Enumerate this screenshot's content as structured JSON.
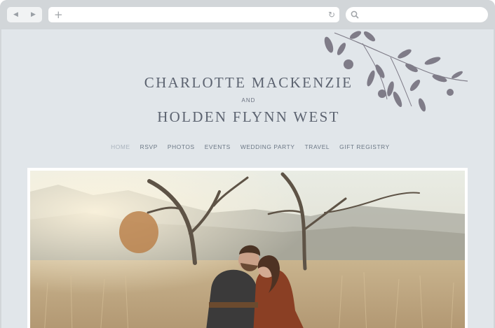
{
  "browser": {
    "back_icon": "back-arrow-icon",
    "forward_icon": "forward-arrow-icon",
    "new_tab_icon": "plus-icon",
    "reload_icon": "reload-icon",
    "search_icon": "search-icon",
    "back_glyph": "◀",
    "forward_glyph": "▶",
    "plus_glyph": "+",
    "reload_glyph": "↻"
  },
  "site": {
    "name_line1": "CHARLOTTE MACKENZIE",
    "connector": "AND",
    "name_line2": "HOLDEN FLYNN WEST",
    "nav": [
      "HOME",
      "RSVP",
      "PHOTOS",
      "EVENTS",
      "WEDDING PARTY",
      "TRAVEL",
      "GIFT REGISTRY"
    ],
    "active_nav": "HOME",
    "hero_image": "couple-in-field-photo",
    "decoration": "leafy-branch-illustration"
  },
  "colors": {
    "page_bg": "#e1e6ea",
    "chrome_bg": "#d2d6d9",
    "name_text": "#5c6370",
    "nav_text": "#6b7785",
    "nav_active": "#a9b3bd",
    "leaf": "#6f6a78"
  }
}
